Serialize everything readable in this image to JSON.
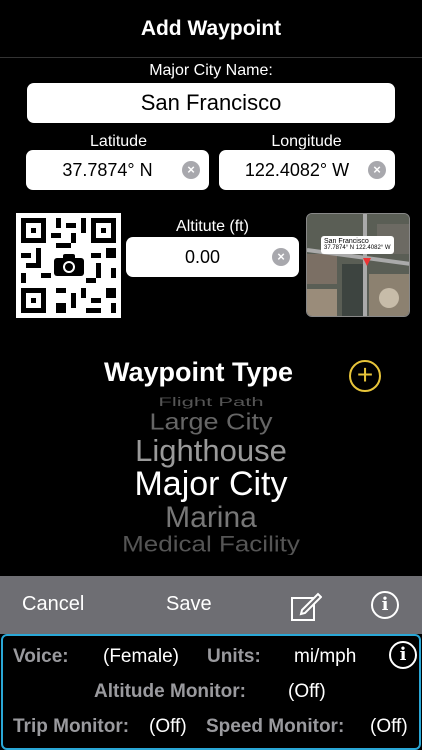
{
  "nav": {
    "title": "Add Waypoint"
  },
  "city": {
    "label": "Major City Name:",
    "value": "San Francisco"
  },
  "latitude": {
    "label": "Latitude",
    "value": "37.7874° N"
  },
  "longitude": {
    "label": "Longitude",
    "value": "122.4082° W"
  },
  "altitude": {
    "label": "Altitute (ft)",
    "value": "0.00"
  },
  "map": {
    "callout_title": "San Francisco",
    "callout_coords": "37.7874° N 122.4082° W"
  },
  "waypoint_type": {
    "title": "Waypoint Type",
    "options": [
      "Large City",
      "Lighthouse",
      "Major City",
      "Marina",
      "Medical Facility"
    ],
    "selected": "Major City"
  },
  "toolbar": {
    "cancel": "Cancel",
    "save": "Save"
  },
  "settings": {
    "voice_label": "Voice:",
    "voice_value": "(Female)",
    "units_label": "Units:",
    "units_value": "mi/mph",
    "altitude_monitor_label": "Altitude Monitor:",
    "altitude_monitor_value": "(Off)",
    "trip_monitor_label": "Trip Monitor:",
    "trip_monitor_value": "(Off)",
    "speed_monitor_label": "Speed Monitor:",
    "speed_monitor_value": "(Off)"
  },
  "colors": {
    "accent_yellow": "#e8c53a",
    "panel_border": "#2aa7d6",
    "toolbar_bg": "#6e6e73"
  },
  "icons": [
    "clear-icon",
    "camera-icon",
    "add-circle-icon",
    "edit-icon",
    "info-icon"
  ]
}
